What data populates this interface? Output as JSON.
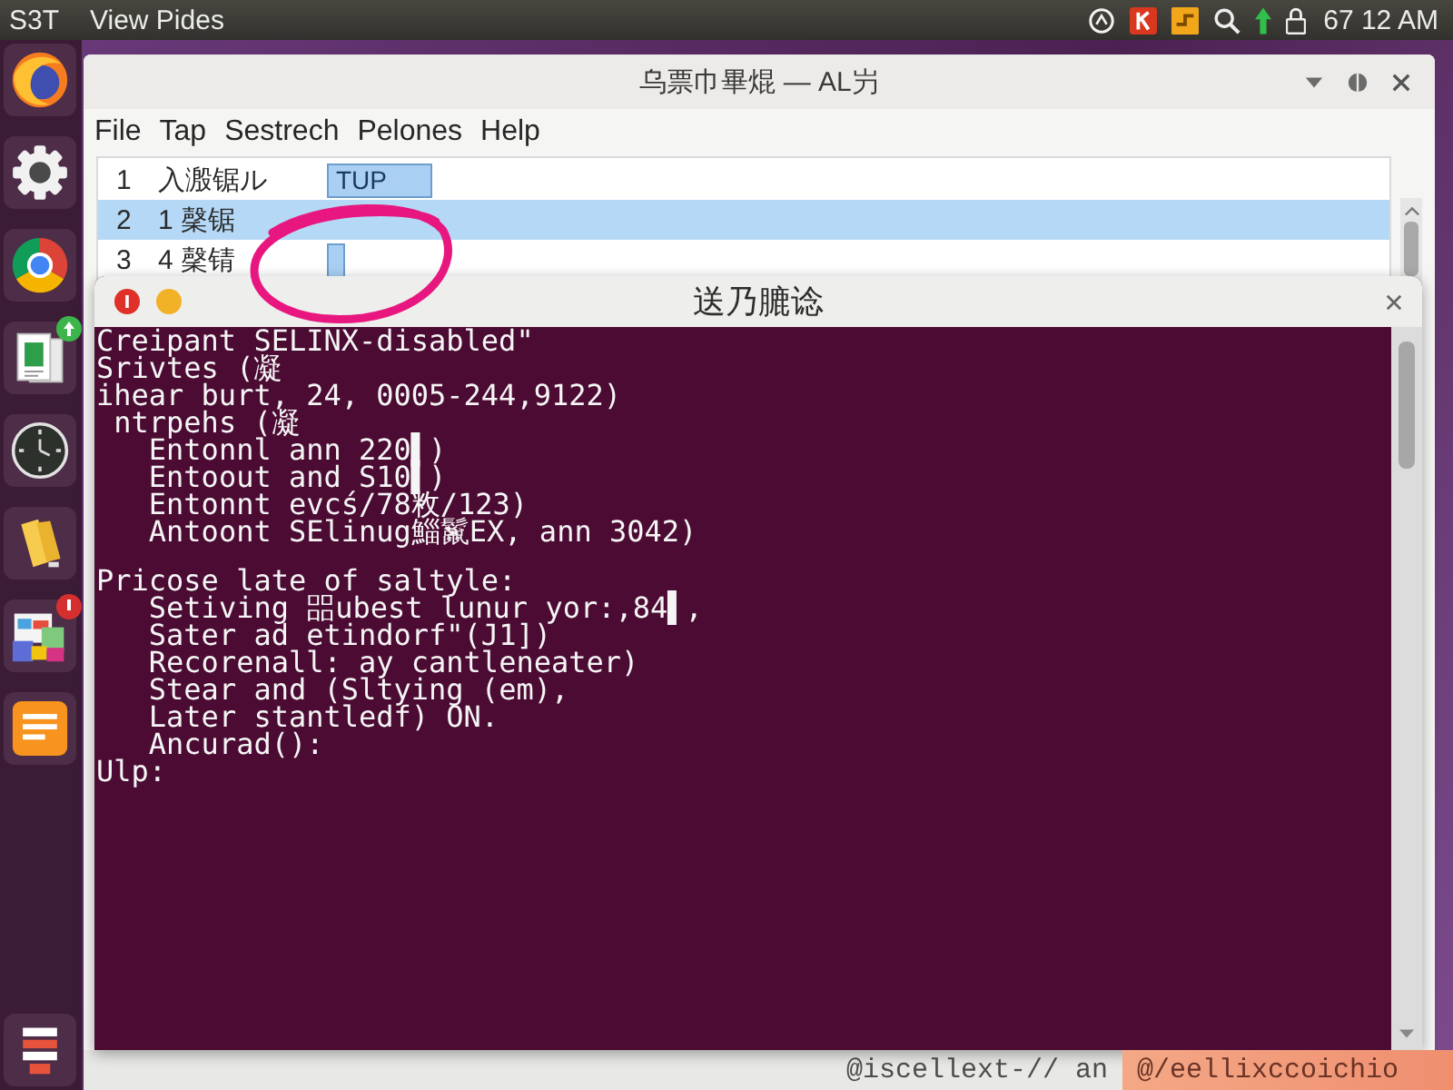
{
  "top_bar": {
    "app_name": "S3T",
    "menu_title": "View Pides",
    "clock": "67 12 AM"
  },
  "window": {
    "title": "乌票巾畢焜 — AL屶",
    "menu": [
      "File",
      "Tap",
      "Sestrech",
      "Pelones",
      "Help"
    ],
    "rows": [
      {
        "number": "1",
        "label": "入溵锯ル",
        "kind": "field",
        "value": "TUP",
        "selected": false
      },
      {
        "number": "2",
        "label": "1 䅽锯",
        "kind": "plain",
        "selected": true
      },
      {
        "number": "3",
        "label": "4 䅽锖",
        "kind": "field",
        "selected": false
      }
    ],
    "status_text": "@iscellext-// an"
  },
  "terminal": {
    "title": "送乃膔谂",
    "blocks": [
      [
        "Creipant SELINX-disabled\"",
        "Srivtes (凝",
        "ihear burt, 24, 0005-244,9122)",
        " ntrpehs (凝",
        "   Entonnl ann 220▌)",
        "   Entoout and S10▌)",
        "   Entonnt evcś/78敉/123)",
        "   Antoont SElinug鯔鬣EX, ann 3042)"
      ],
      [
        "Pricose late of saltyle:",
        "   Setiving 㗊ubest lunur yor:,84▌,",
        "   Sater ad etindorf\"(J1])",
        "   Recorenall: ay cantleneater)",
        "   Stear and (Sltying (em),",
        "   Later stantledf) ON.",
        "   Ancurad():",
        "Ulp:"
      ]
    ]
  },
  "notification": {
    "text": "@/eellixccoichio"
  }
}
